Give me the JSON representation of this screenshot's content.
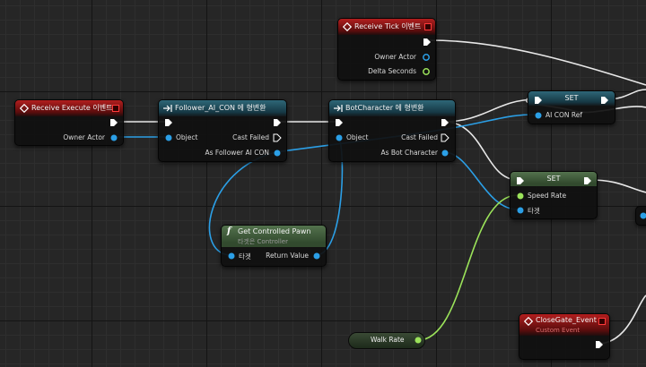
{
  "nodes": {
    "receive_tick": {
      "title": "Receive Tick 이벤트",
      "pins": {
        "owner_actor": "Owner Actor",
        "delta_seconds": "Delta Seconds"
      }
    },
    "receive_execute": {
      "title": "Receive Execute 이벤트",
      "pins": {
        "owner_actor": "Owner Actor"
      }
    },
    "cast_follower": {
      "title": "Follower_AI_CON 에 형변환",
      "pins": {
        "object": "Object",
        "cast_failed": "Cast Failed",
        "as_output": "As Follower AI CON"
      }
    },
    "cast_bot": {
      "title": "BotCharacter 에 형변환",
      "pins": {
        "object": "Object",
        "cast_failed": "Cast Failed",
        "as_output": "As Bot Character"
      }
    },
    "set_top": {
      "title": "SET",
      "pins": {
        "ai_con_ref": "AI CON Ref"
      }
    },
    "set_speed": {
      "title": "SET",
      "pins": {
        "speed_rate": "Speed Rate",
        "target": "타겟"
      }
    },
    "get_pawn": {
      "title": "Get Controlled Pawn",
      "subtitle": "타겟은 Controller",
      "pins": {
        "target": "타겟",
        "return_value": "Return Value"
      }
    },
    "walk_rate": {
      "title": "Walk Rate"
    },
    "close_gate": {
      "title": "CloseGate_Event",
      "subtitle": "Custom Event"
    }
  },
  "colors": {
    "exec": "#ffffff",
    "object": "#1e9ae8",
    "float": "#9be35a",
    "event_header": "#b21e1e",
    "cast_header": "#2e6778"
  },
  "icons": {
    "event": "event-diamond-icon",
    "cast": "cast-arrows-icon",
    "function": "function-f-icon",
    "delegate": "delegate-square-icon"
  }
}
